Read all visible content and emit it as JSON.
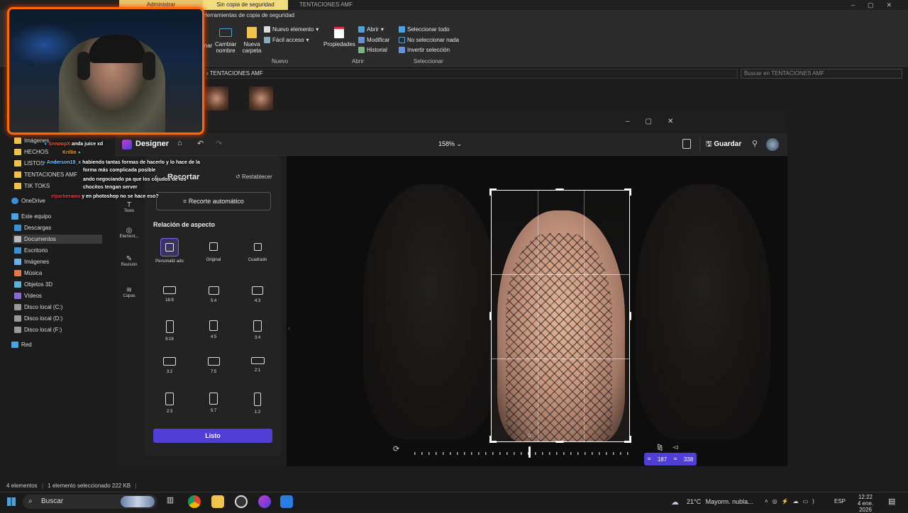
{
  "explorer": {
    "context_tabs": [
      "Administrar",
      "Sin copia de seguridad"
    ],
    "window_title": "TENTACIONES AMF",
    "ribbon_tab": "Herramientas de copia de seguridad",
    "ribbon": {
      "eliminar": "inar",
      "cambiar_nombre": "Cambiar nombre",
      "nueva_carpeta": "Nueva carpeta",
      "nuevo_elemento": "Nuevo elemento",
      "facil_acceso": "Fácil acceso",
      "propiedades": "Propiedades",
      "abrir": "Abrir",
      "modificar": "Modificar",
      "historial": "Historial",
      "seleccionar_todo": "Seleccionar todo",
      "no_seleccionar_nada": "No seleccionar nada",
      "invertir_seleccion": "Invertir selección",
      "group_nuevo": "Nuevo",
      "group_abrir": "Abrir",
      "group_seleccionar": "Seleccionar"
    },
    "address": "TENTACIONES AMF",
    "search_placeholder": "Buscar en TENTACIONES AMF",
    "nav": {
      "imagenes_top": "Imágenes",
      "hechos": "HECHOS",
      "listos": "LISTOS",
      "tentaciones": "TENTACIONES AMF",
      "tiktoks": "TIK TOKS",
      "onedrive": "OneDrive",
      "este_equipo": "Este equipo",
      "descargas": "Descargas",
      "documentos": "Documentos",
      "escritorio": "Escritorio",
      "imagenes": "Imágenes",
      "musica": "Música",
      "objetos3d": "Objetos 3D",
      "videos": "Vídeos",
      "disco_c": "Disco local (C:)",
      "disco_d": "Disco local (D:)",
      "disco_f": "Disco local (F:)",
      "red": "Red"
    },
    "status": {
      "elementos": "4 elementos",
      "seleccionado": "1 elemento seleccionado  222 KB"
    }
  },
  "chat": {
    "user1": "SnnoopX",
    "msg1": "anda juice xd",
    "user2": "Krillin",
    "user3": "Anderson19_x",
    "msg3a": "habiendo tantas formas de hacerlo y lo hace de la",
    "msg3b": "forma más complicada posible",
    "msg4": "ando negociando pa que los cojudos de los",
    "msg4b": "chocitos tengan server",
    "user5": "elparkeruwu",
    "msg5": "y en photoshop no se hace eso?"
  },
  "designer": {
    "app_name": "Designer",
    "zoom": "158%",
    "save_label": "Guardar",
    "panel_title": "Recortar",
    "reset_label": "Restablecer",
    "auto_crop": "Recorte automático",
    "aspect_title": "Relación de aspecto",
    "tools": [
      "Texto",
      "Element...",
      "Revisión",
      "Capas"
    ],
    "aspects_top": [
      {
        "label": "Personaliz ado"
      },
      {
        "label": "Original"
      },
      {
        "label": "Cuadrado"
      }
    ],
    "aspects_grid": [
      "16:9",
      "5:4",
      "4:3",
      "9:16",
      "4:5",
      "3:4",
      "3:2",
      "7:5",
      "2:1",
      "2:3",
      "5:7",
      "1:2"
    ],
    "done_label": "Listo",
    "rotation_value": "0",
    "crop_width": "187",
    "crop_height": "338"
  },
  "taskbar": {
    "search": "Buscar",
    "weather_temp": "21°C",
    "weather_desc": "Mayorm. nubla...",
    "lang": "ESP",
    "time": "12:22",
    "date": "4 ene. 2026"
  },
  "colors": {
    "accent": "#4f3fd6",
    "webcam_border": "#ff6a00",
    "folder": "#f0c44c"
  }
}
